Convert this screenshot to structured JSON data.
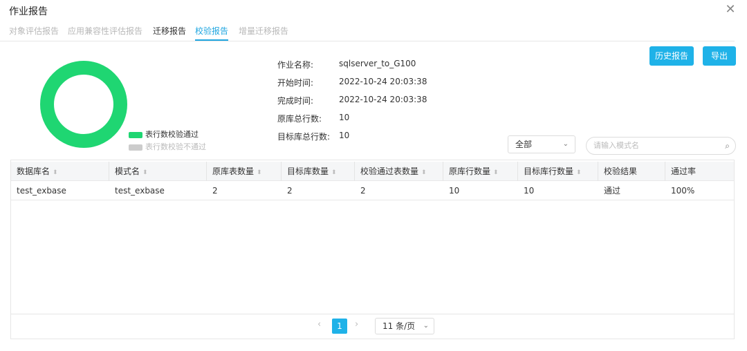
{
  "dialog": {
    "title": "作业报告",
    "close_icon": "close-icon"
  },
  "tabs": [
    {
      "label": "对象评估报告"
    },
    {
      "label": "应用兼容性评估报告"
    },
    {
      "label": "迁移报告"
    },
    {
      "label": "校验报告"
    },
    {
      "label": "增量迁移报告"
    }
  ],
  "chart_data": {
    "type": "pie",
    "categories": [
      "表行数校验通过",
      "表行数校验不通过"
    ],
    "values": [
      1,
      0
    ],
    "colors": [
      "#1fd672",
      "#cccccc"
    ],
    "legend": "right-bottom"
  },
  "info": {
    "job_name_label": "作业名称:",
    "job_name": "sqlserver_to_G100",
    "start_label": "开始时间:",
    "start_time": "2022-10-24 20:03:38",
    "end_label": "完成时间:",
    "end_time": "2022-10-24 20:03:38",
    "src_rows_label": "原库总行数:",
    "src_rows": "10",
    "dst_rows_label": "目标库总行数:",
    "dst_rows": "10"
  },
  "buttons": {
    "history": "历史报告",
    "export": "导出"
  },
  "filter": {
    "selected": "全部",
    "search_placeholder": "请输入模式名"
  },
  "table": {
    "columns": [
      "数据库名",
      "模式名",
      "原库表数量",
      "目标库数量",
      "校验通过表数量",
      "原库行数量",
      "目标库行数量",
      "校验结果",
      "通过率"
    ],
    "rows": [
      [
        "test_exbase",
        "test_exbase",
        "2",
        "2",
        "2",
        "10",
        "10",
        "通过",
        "100%"
      ]
    ]
  },
  "pagination": {
    "current_page": "1",
    "page_size": "11 条/页"
  },
  "colors": {
    "accent": "#1fb2e8",
    "pass": "#1fd672",
    "fail": "#cccccc"
  }
}
